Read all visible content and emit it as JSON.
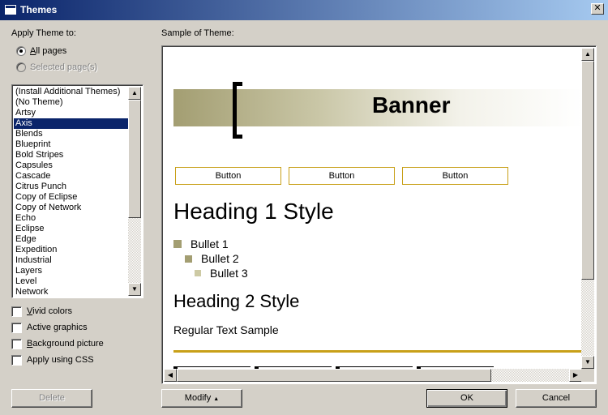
{
  "window": {
    "title": "Themes",
    "close_glyph": "✕"
  },
  "apply": {
    "label": "Apply Theme to:",
    "options": [
      {
        "label": "All pages",
        "checked": true,
        "enabled": true
      },
      {
        "label": "Selected page(s)",
        "checked": false,
        "enabled": false
      }
    ]
  },
  "themes": {
    "items": [
      "(Install Additional Themes)",
      "(No Theme)",
      "Artsy",
      "Axis",
      "Blends",
      "Blueprint",
      "Bold Stripes",
      "Capsules",
      "Cascade",
      "Citrus Punch",
      "Copy of Eclipse",
      "Copy of Network",
      "Echo",
      "Eclipse",
      "Edge",
      "Expedition",
      "Industrial",
      "Layers",
      "Level",
      "Network"
    ],
    "selected": "Axis"
  },
  "options": {
    "vivid": "Vivid colors",
    "active": "Active graphics",
    "background": "Background picture",
    "css": "Apply using CSS"
  },
  "sample": {
    "label": "Sample of Theme:",
    "banner": "Banner",
    "button_label": "Button",
    "heading1": "Heading 1 Style",
    "bullets": [
      "Bullet 1",
      "Bullet 2",
      "Bullet 3"
    ],
    "heading2": "Heading 2 Style",
    "regular": "Regular Text Sample"
  },
  "buttons": {
    "delete": "Delete",
    "modify": "Modify",
    "modify_arrow": "▲",
    "ok": "OK",
    "cancel": "Cancel"
  },
  "colors": {
    "accent": "#c8a018",
    "banner_base": "#a39e72",
    "selection": "#0a246a",
    "bullet1": "#a39e72",
    "bullet2": "#a39e72",
    "bullet3": "#cdcaa4"
  },
  "scroll_glyphs": {
    "up": "▲",
    "down": "▼",
    "left": "◀",
    "right": "▶"
  }
}
